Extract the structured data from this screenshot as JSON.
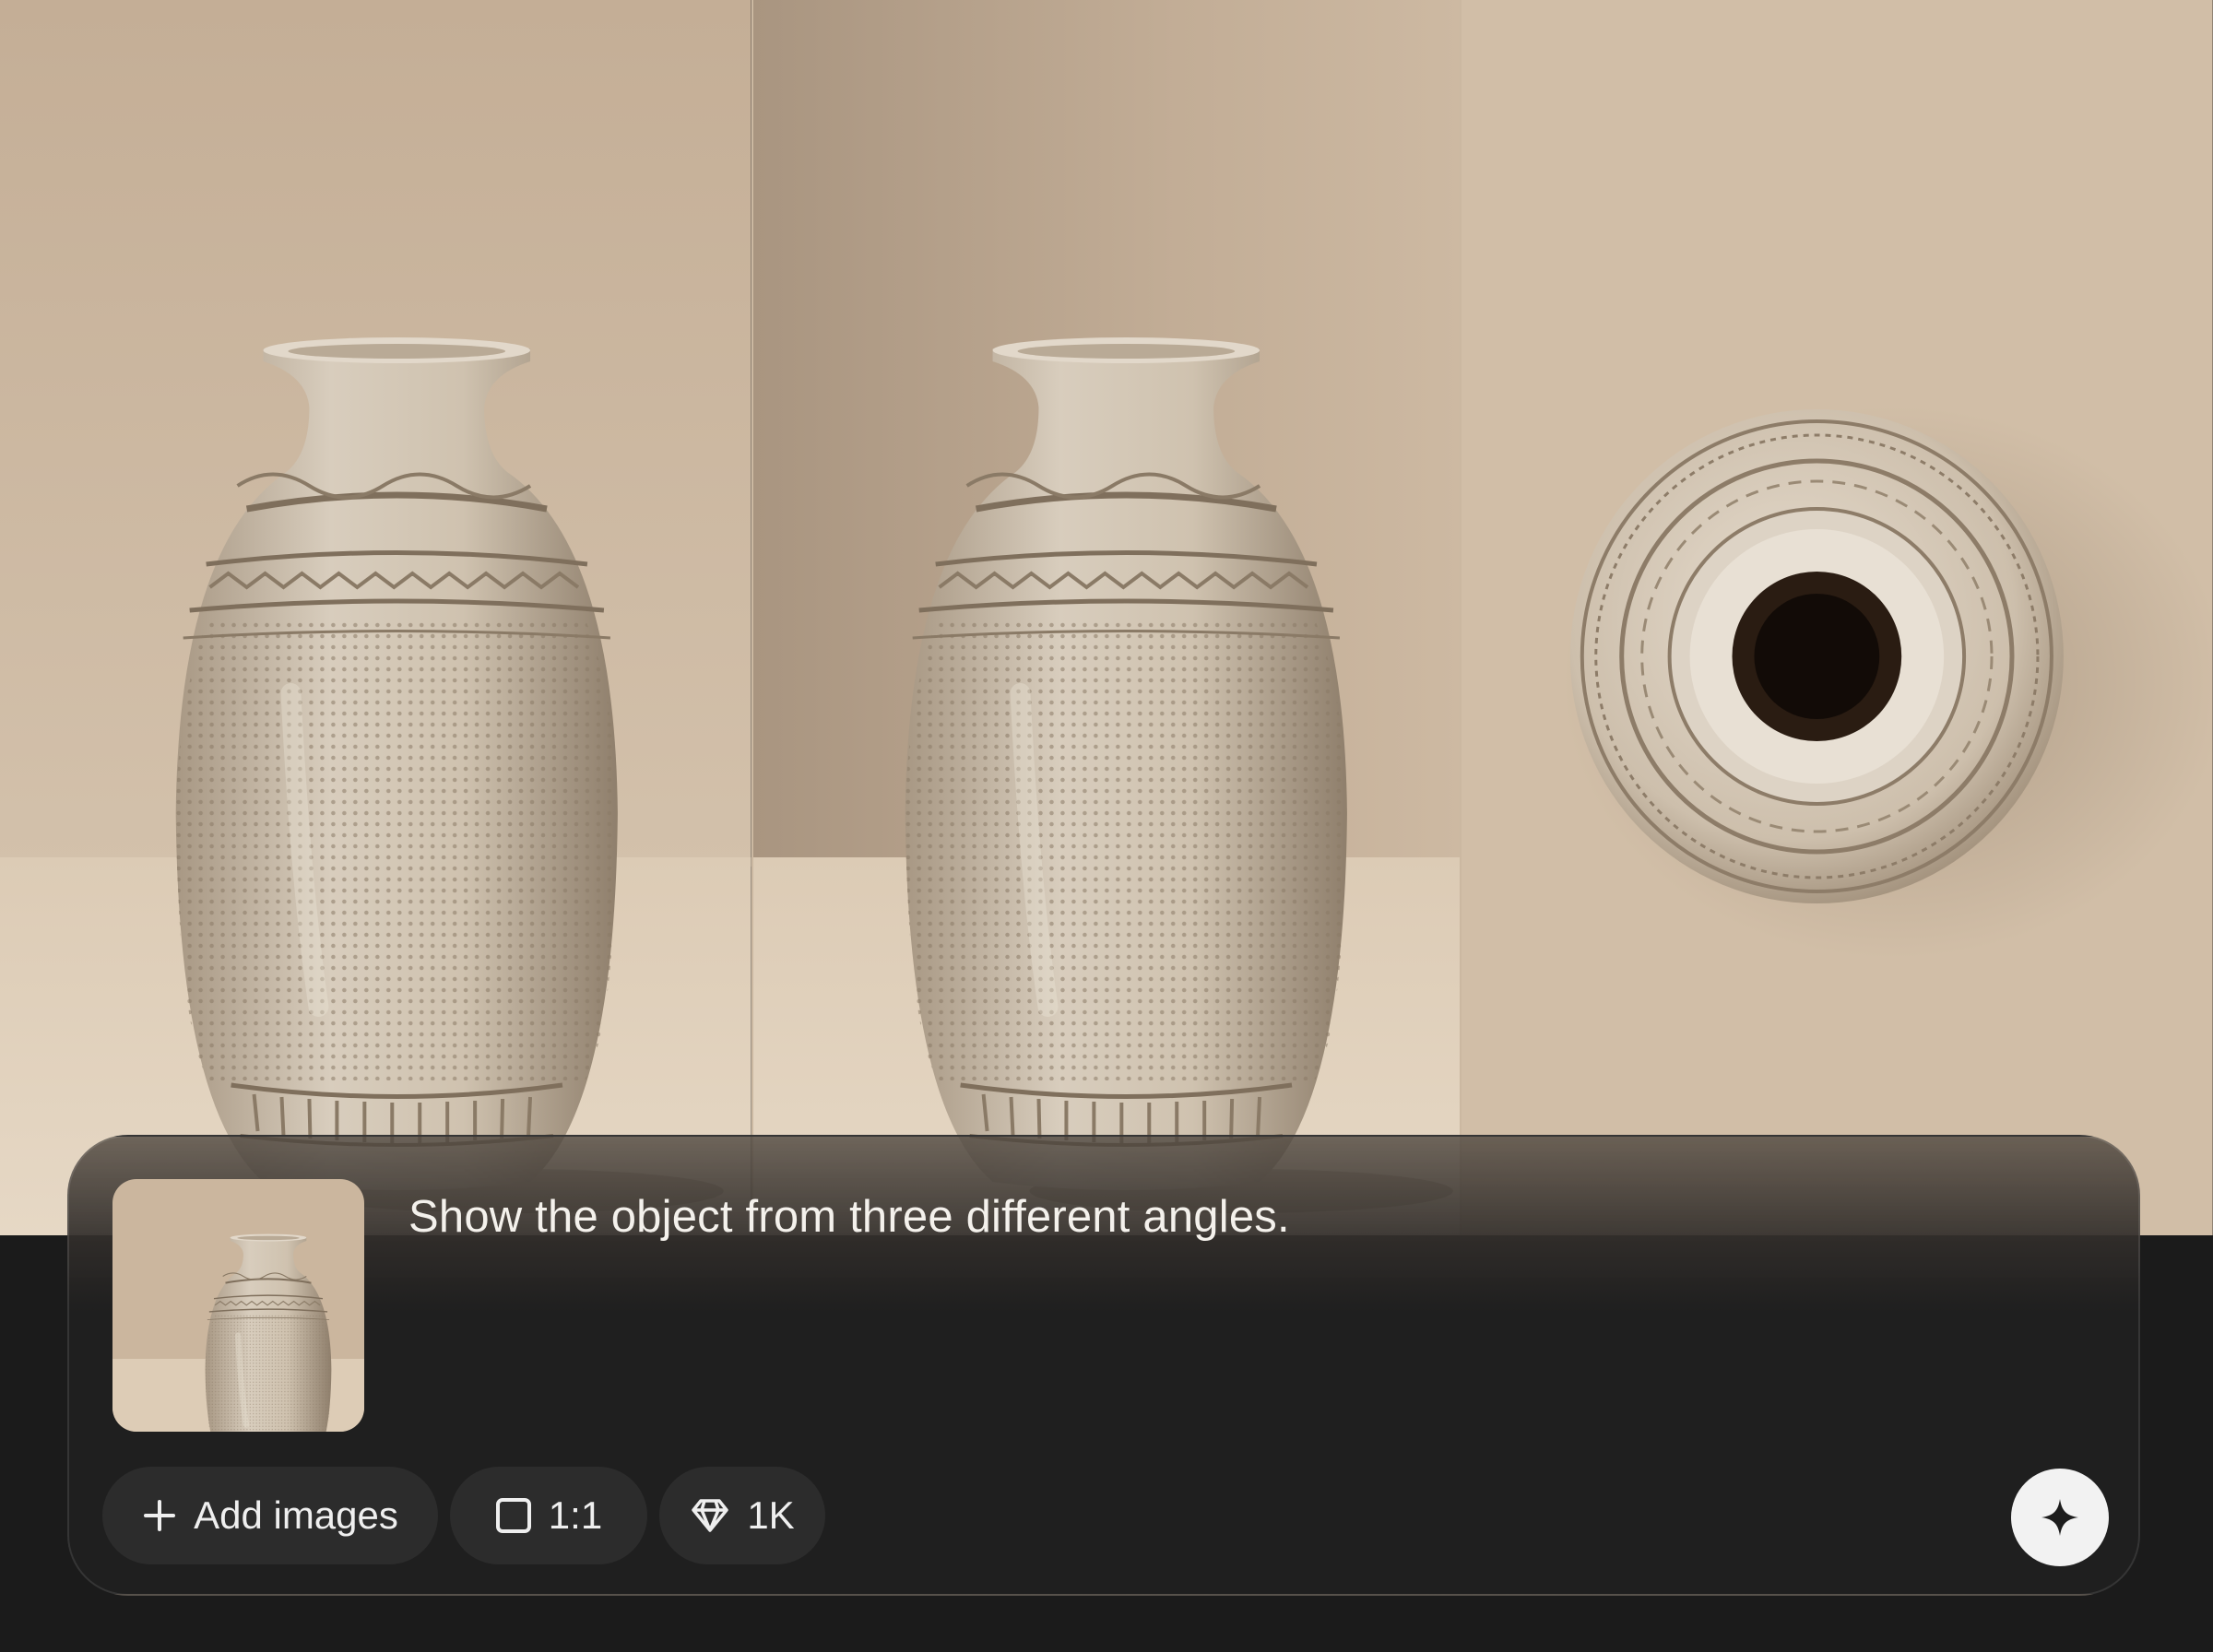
{
  "gallery": {
    "images": [
      {
        "view": "front view",
        "icon": "vase-image"
      },
      {
        "view": "front view",
        "icon": "vase-image"
      },
      {
        "view": "top-down view",
        "icon": "vase-top-image"
      }
    ]
  },
  "composer": {
    "reference_image": {
      "icon": "vase-thumbnail"
    },
    "prompt_text": "Show the object from three different angles.",
    "add_images_label": "Add images",
    "aspect_ratio_label": "1:1",
    "resolution_label": "1K",
    "icons": {
      "add": "plus-icon",
      "ratio": "square-icon",
      "resolution": "diamond-icon",
      "generate": "sparkle-icon"
    },
    "colors": {
      "card_background": "#1f1f1f",
      "chip_background": "#2c2c2c",
      "send_button": "#f2f2f2",
      "page_background": "#1b1b1b"
    }
  }
}
